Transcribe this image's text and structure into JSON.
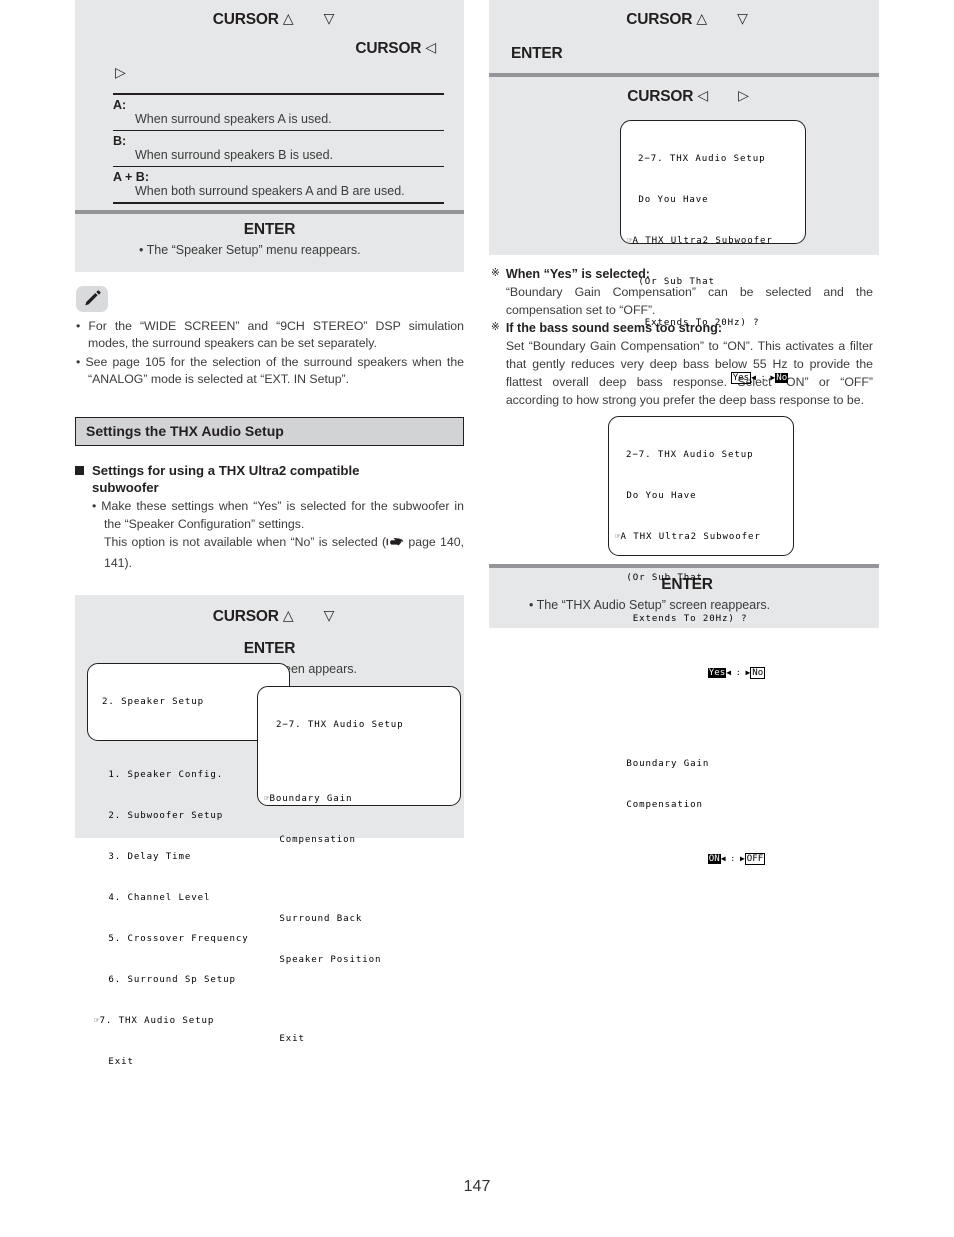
{
  "page": {
    "number": "147"
  },
  "left": {
    "panel_top": {
      "cursor_row1": {
        "label": "CURSOR",
        "glyph_up": "△",
        "glyph_down": "▽"
      },
      "cursor_row2": {
        "label": "CURSOR",
        "glyph_left": "◁"
      },
      "cursor_row3": {
        "glyph_right": "▷"
      },
      "definitions": [
        {
          "term": "A:",
          "desc": "When surround speakers A is used."
        },
        {
          "term": "B:",
          "desc": "When surround speakers B is used."
        },
        {
          "term": "A + B:",
          "desc": "When both surround speakers A and B are used."
        }
      ],
      "enter_label": "ENTER",
      "enter_note": "• The “Speaker Setup” menu reappears."
    },
    "note": {
      "icon": "pencil-icon",
      "items": [
        "• For the “WIDE SCREEN” and “9CH STEREO” DSP simulation modes, the surround speakers can be set separately.",
        "• See page 105 for the selection of the surround speakers when the “ANALOG” mode is selected at “EXT. IN Setup”."
      ]
    },
    "section_title": "Settings the THX Audio Setup",
    "subsection": {
      "heading": "Settings for using a THX Ultra2 compatible subwoofer",
      "para1": "• Make these settings when “Yes” is selected for the subwoofer in the “Speaker Configuration” settings.",
      "para2_pre": "This option is not available when “No” is selected (",
      "para2_post": " page 140, 141)."
    },
    "panel_bottom": {
      "cursor_row": {
        "label": "CURSOR",
        "glyph_up": "△",
        "glyph_down": "▽"
      },
      "enter_label": "ENTER",
      "enter_note": "• The “THX Audio Setup” screen appears."
    },
    "osd_speaker_setup": {
      "title": "2. Speaker Setup",
      "lines": [
        " 1. Speaker Config.",
        " 2. Subwoofer Setup",
        " 3. Delay Time",
        " 4. Channel Level",
        " 5. Crossover Frequency",
        " 6. Surround Sp Setup",
        "7. THX Audio Setup",
        " Exit"
      ],
      "pointer_line_index": 6,
      "pointer_glyph": "☞"
    },
    "osd_thx_audio_setup": {
      "title": "2−7. THX Audio Setup",
      "lines": [
        "Boundary Gain",
        " Compensation",
        "",
        " Surround Back",
        " Speaker Position",
        "",
        " Exit"
      ],
      "pointer_glyph": "☞"
    }
  },
  "right": {
    "panel_top": {
      "cursor_row1": {
        "label": "CURSOR",
        "glyph_up": "△",
        "glyph_down": "▽"
      },
      "enter_label": "ENTER",
      "cursor_row2": {
        "label": "CURSOR",
        "glyph_left": "◁",
        "glyph_right": "▷"
      }
    },
    "osd_question": {
      "title": "2−7. THX Audio Setup",
      "line1": " Do You Have",
      "line2": "A THX Ultra2 Subwoofer",
      "line3": " (Or Sub That",
      "line4": "  Extends To 20Hz) ?",
      "option_yes": "Yes",
      "option_no": "No",
      "separator": "◀ : ▶",
      "selected": "No",
      "pointer_glyph": "☞"
    },
    "notes": [
      {
        "mark": "※",
        "bold": "When “Yes” is selected:",
        "body": "“Boundary Gain Compensation” can be selected and the compensation set to “OFF”."
      },
      {
        "mark": "※",
        "bold": "If the bass sound seems too strong:",
        "body": "Set “Boundary Gain Compensation” to “ON”. This activates a filter that gently reduces very deep bass below 55 Hz to provide the flattest overall deep bass response. Select “ON” or “OFF” according to how strong you prefer the deep bass response to be."
      }
    ],
    "osd_question2": {
      "title": "2−7. THX Audio Setup",
      "line1": " Do You Have",
      "line2": "A THX Ultra2 Subwoofer",
      "line3": " (Or Sub That",
      "line4": "  Extends To 20Hz) ?",
      "option_yes": "Yes",
      "option_no": "No",
      "selected_top": "Yes",
      "bgc_line1": " Boundary Gain",
      "bgc_line2": " Compensation",
      "option_on": "ON",
      "option_off": "OFF",
      "selected_bottom": "ON",
      "separator": "◀ : ▶",
      "pointer_glyph": "☞"
    },
    "panel_bottom": {
      "enter_label": "ENTER",
      "enter_note": "• The “THX Audio Setup” screen reappears."
    }
  },
  "colors": {
    "panel_bg": "#e6e7e8",
    "section_bar_bg": "#d1d3d4",
    "ink": "#231f20",
    "gray_rule": "#939598"
  }
}
